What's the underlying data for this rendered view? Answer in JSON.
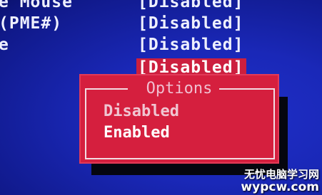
{
  "bios": {
    "settings": [
      {
        "label": "e Mouse",
        "value": "[Disabled]"
      },
      {
        "label": "(PME#)",
        "value": "[Disabled]"
      },
      {
        "label": "e",
        "value": "[Disabled]"
      },
      {
        "label": "",
        "value": "[Disabled]"
      }
    ]
  },
  "popup": {
    "title": "Options",
    "options": [
      "Disabled",
      "Enabled"
    ],
    "highlighted": "Enabled"
  },
  "watermark": {
    "site_name": "无忧电脑学习网",
    "url": "wypcw.com"
  },
  "colors": {
    "background": "#1a28b8",
    "popup": "#d51f3e",
    "text": "#eef0ff",
    "shadow": "#05060f"
  }
}
